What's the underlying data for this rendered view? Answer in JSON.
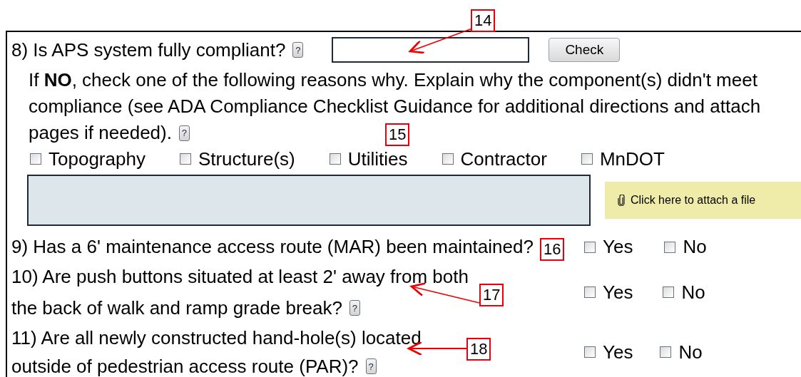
{
  "q8": {
    "label": "8) Is APS system fully compliant?",
    "help": "?",
    "button": "Check"
  },
  "reasons": {
    "lines": [
      "If **NO**, check one of the following reasons why. Explain why the component(s) didn't meet",
      "compliance (see ADA Compliance Checklist Guidance for additional directions and attach",
      "pages if needed)."
    ],
    "help": "?",
    "options": [
      {
        "label": "Topography",
        "checked": false
      },
      {
        "label": "Structure(s)",
        "checked": false
      },
      {
        "label": "Utilities",
        "checked": false
      },
      {
        "label": "Contractor",
        "checked": false
      },
      {
        "label": "MnDOT",
        "checked": false
      }
    ],
    "attach": "Click here to attach a file"
  },
  "questions": [
    {
      "lines": [
        "9) Has a 6' maintenance access route (MAR) been maintained?"
      ],
      "options": [
        {
          "label": "Yes",
          "checked": false
        },
        {
          "label": "No",
          "checked": false
        }
      ]
    },
    {
      "lines": [
        "10) Are push buttons situated at least 2' away from both",
        "the back of walk and ramp grade break?"
      ],
      "help": "?",
      "options": [
        {
          "label": "Yes",
          "checked": false
        },
        {
          "label": "No",
          "checked": false
        }
      ]
    },
    {
      "lines": [
        "11) Are all newly constructed hand-hole(s) located",
        "outside of pedestrian access route (PAR)?"
      ],
      "help": "?",
      "options": [
        {
          "label": "Yes",
          "checked": false
        },
        {
          "label": "No",
          "checked": false
        }
      ]
    }
  ],
  "annotations": [
    {
      "label": "14"
    },
    {
      "label": "15"
    },
    {
      "label": "16"
    },
    {
      "label": "17"
    },
    {
      "label": "18"
    }
  ]
}
